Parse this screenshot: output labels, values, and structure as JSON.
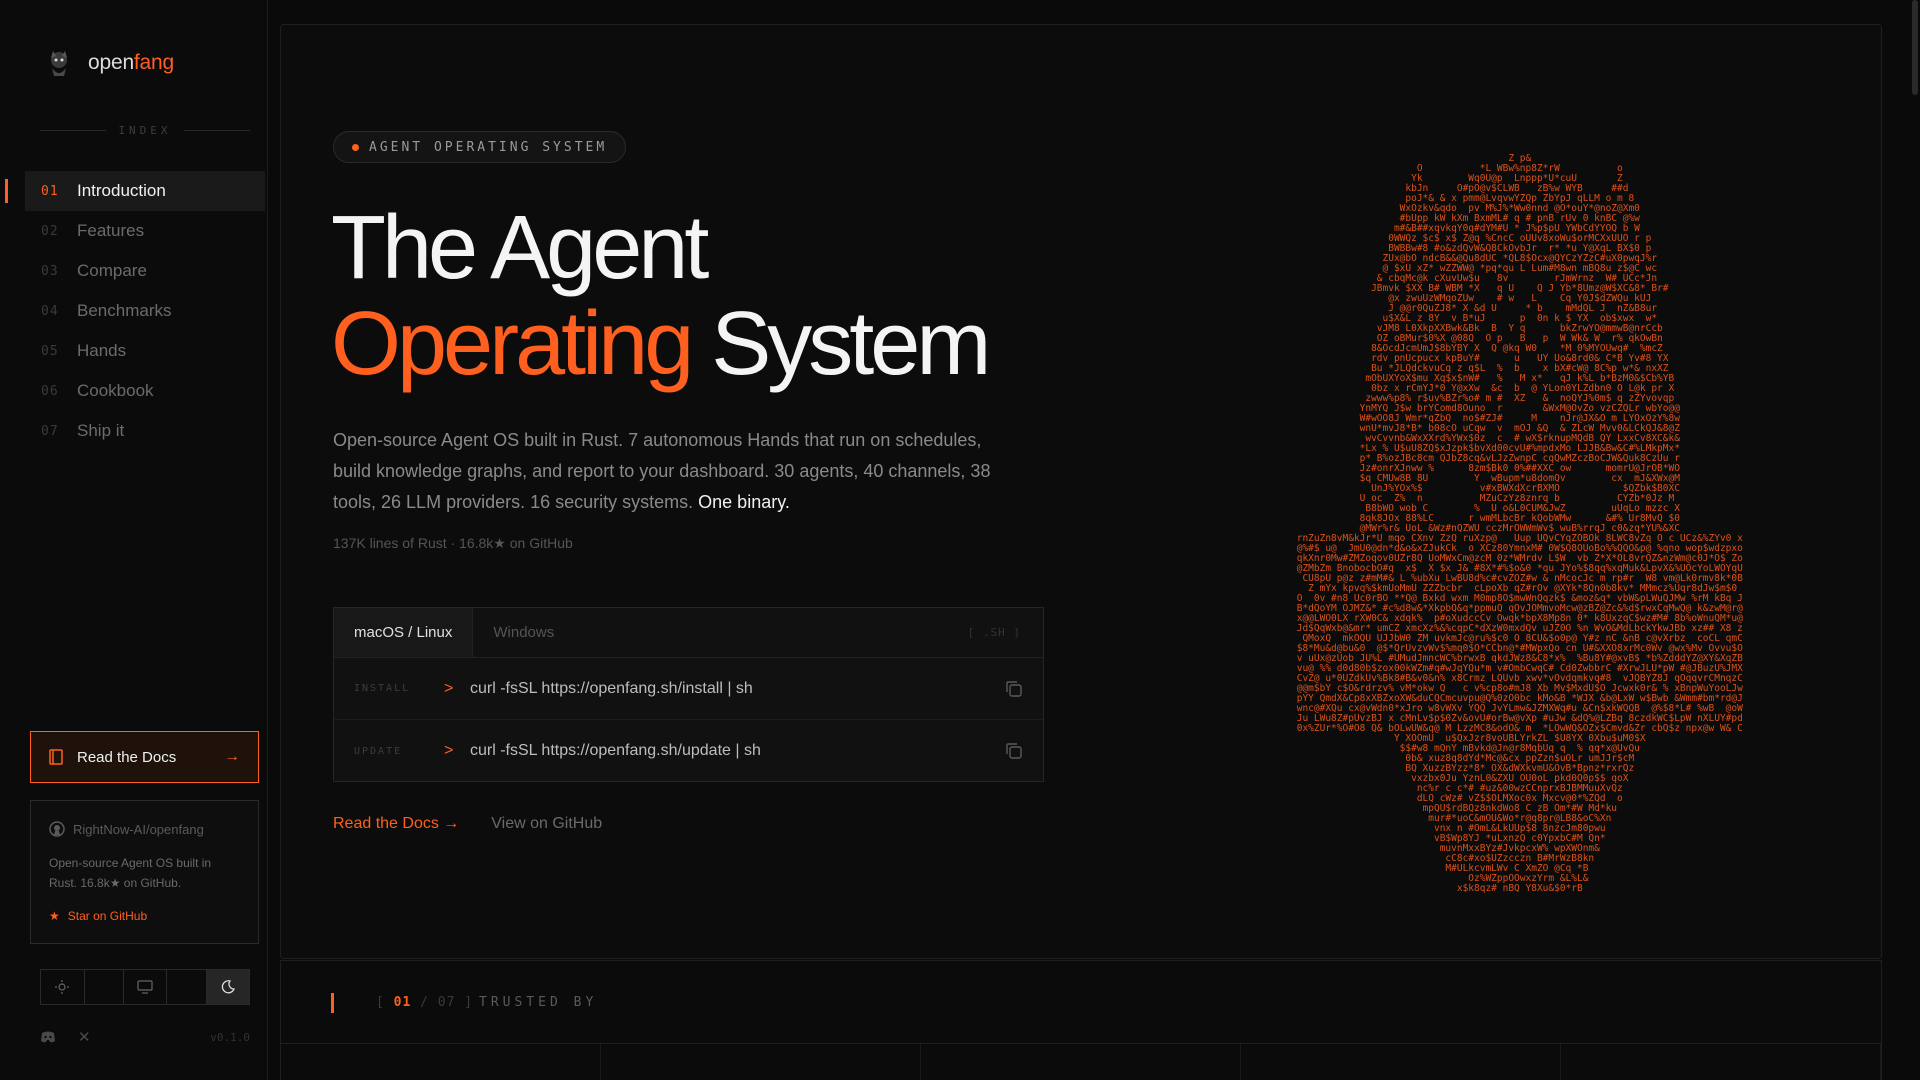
{
  "brand": {
    "name_a": "open",
    "name_b": "fang"
  },
  "sidebar": {
    "index_label": "INDEX",
    "items": [
      {
        "num": "01",
        "label": "Introduction",
        "active": true
      },
      {
        "num": "02",
        "label": "Features"
      },
      {
        "num": "03",
        "label": "Compare"
      },
      {
        "num": "04",
        "label": "Benchmarks"
      },
      {
        "num": "05",
        "label": "Hands"
      },
      {
        "num": "06",
        "label": "Cookbook"
      },
      {
        "num": "07",
        "label": "Ship it"
      }
    ],
    "docs_button": "Read the Docs",
    "github_card": {
      "repo": "RightNow-AI/openfang",
      "description": "Open-source Agent OS built in Rust. 16.8k★ on GitHub.",
      "star_label": "Star on GitHub"
    },
    "version": "v0.1.0"
  },
  "hero": {
    "badge": "AGENT OPERATING SYSTEM",
    "title_line1": "The Agent",
    "title_accent": "Operating",
    "title_rest": " System",
    "description": "Open-source Agent OS built in Rust. 7 autonomous Hands that run on schedules, build knowledge graphs, and report to your dashboard. 30 agents, 40 channels, 38 tools, 26 LLM providers. 16 security systems. ",
    "description_highlight": "One binary.",
    "meta": "137K lines of Rust · 16.8k★ on GitHub"
  },
  "terminal": {
    "tabs": [
      "macOS / Linux",
      "Windows"
    ],
    "shell_label": "[ .SH ]",
    "rows": [
      {
        "label": "INSTALL",
        "prompt": ">",
        "command": "curl -fsSL https://openfang.sh/install | sh"
      },
      {
        "label": "UPDATE",
        "prompt": ">",
        "command": "curl -fsSL https://openfang.sh/update | sh"
      }
    ]
  },
  "links": {
    "primary": "Read the Docs →",
    "secondary": "View on GitHub"
  },
  "section": {
    "current": "01",
    "total": "/ 07 ]",
    "open": "[ ",
    "label": "TRUSTED BY"
  },
  "colors": {
    "accent": "#ff5f1f",
    "background": "#0a0a0a"
  },
  "icons": [
    "wolf-logo-icon",
    "book-icon",
    "arrow-right-icon",
    "github-icon",
    "star-icon",
    "sun-icon",
    "monitor-icon",
    "moon-icon",
    "discord-icon",
    "x-icon",
    "copy-icon"
  ]
}
